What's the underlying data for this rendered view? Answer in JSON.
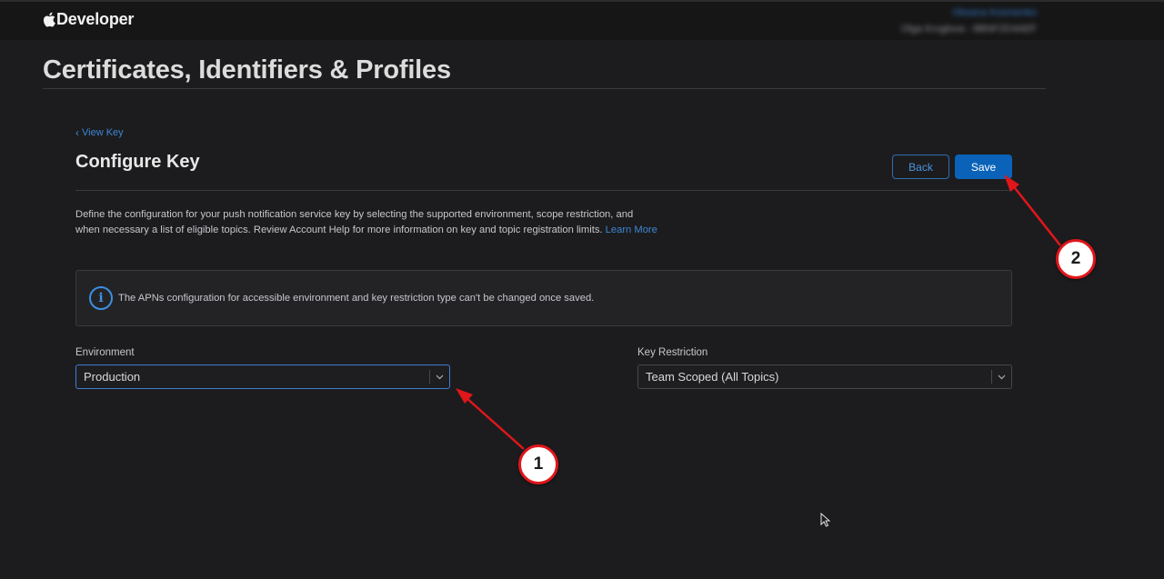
{
  "header": {
    "brand": "Developer",
    "account_link": "Oksana Kosmenko",
    "account_name": "Olga Kruglova - 8BNF2D4AEF"
  },
  "page_title": "Certificates, Identifiers & Profiles",
  "breadcrumb": {
    "chevron": "‹",
    "label": "View Key"
  },
  "section": {
    "title": "Configure Key",
    "back_label": "Back",
    "save_label": "Save"
  },
  "description": {
    "text": "Define the configuration for your push notification service key by selecting the supported environment, scope restriction, and when necessary a list of eligible topics. Review Account Help for more information on key and topic registration limits.",
    "link": "Learn More"
  },
  "notice": {
    "icon": "info-icon",
    "text": "The APNs configuration for accessible environment and key restriction type can't be changed once saved."
  },
  "environment": {
    "label": "Environment",
    "value": "Production"
  },
  "key_restriction": {
    "label": "Key Restriction",
    "value": "Team Scoped (All Topics)"
  },
  "annotations": [
    {
      "number": "1"
    },
    {
      "number": "2"
    }
  ],
  "colors": {
    "accent": "#0a63b8",
    "link": "#3d86d4",
    "annotation": "#e0161b",
    "background": "#1c1c1e"
  }
}
